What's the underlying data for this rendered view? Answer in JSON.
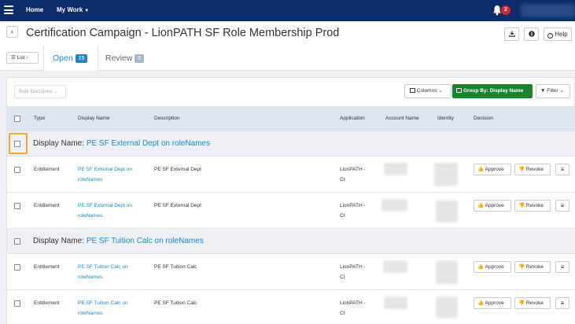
{
  "nav": {
    "home": "Home",
    "my_work": "My Work",
    "notifications_count": "2"
  },
  "header": {
    "title": "Certification Campaign - LionPATH SF Role Membership Prod",
    "help_label": "Help"
  },
  "tabs": {
    "list_label": "List",
    "open": {
      "label": "Open",
      "count": "15"
    },
    "review": {
      "label": "Review",
      "count": "0"
    }
  },
  "toolbar": {
    "bulk_decisions": "Bulk Decisions",
    "columns": "Columns",
    "group_by": "Group By: Display Name",
    "filter": "Filter"
  },
  "table": {
    "headers": [
      "Type",
      "Display Name",
      "Description",
      "Application",
      "Account Name",
      "Identity",
      "Decision"
    ],
    "groups": [
      {
        "prefix": "Display Name:",
        "value": "PE SF External Dept on roleNames",
        "rows": [
          {
            "type": "Entitlement",
            "display_line1": "PE SF External Dept on",
            "display_line2": "roleNames",
            "description": "PE SF External Dept",
            "app_line1": "LionPATH -",
            "app_line2": "CI",
            "approve": "Approve",
            "revoke": "Revoke"
          },
          {
            "type": "Entitlement",
            "display_line1": "PE SF External Dept on",
            "display_line2": "roleNames",
            "description": "PE SF External Dept",
            "app_line1": "LionPATH -",
            "app_line2": "CI",
            "approve": "Approve",
            "revoke": "Revoke"
          }
        ]
      },
      {
        "prefix": "Display Name:",
        "value": "PE SF Tuition Calc on roleNames",
        "rows": [
          {
            "type": "Entitlement",
            "display_line1": "PE SF Tuition Calc on",
            "display_line2": "roleNames",
            "description": "PE SF Tuition Calc",
            "app_line1": "LionPATH -",
            "app_line2": "CI",
            "approve": "Approve",
            "revoke": "Revoke"
          },
          {
            "type": "Entitlement",
            "display_line1": "PE SF Tuition Calc on",
            "display_line2": "roleNames",
            "description": "PE SF Tuition Calc",
            "app_line1": "LionPATH -",
            "app_line2": "CI",
            "approve": "Approve",
            "revoke": "Revoke"
          }
        ]
      }
    ]
  },
  "colors": {
    "nav_bg": "#0b2d6b",
    "accent": "#1e88c7",
    "group_by_green": "#19852f",
    "badge_red": "#d9262c",
    "highlight_orange": "#f2a93b"
  },
  "icons": [
    "menu-icon",
    "bell-icon",
    "chevron-left-icon",
    "download-icon",
    "info-icon",
    "help-icon",
    "list-icon",
    "columns-icon",
    "filter-icon",
    "thumbs-up-icon",
    "thumbs-down-icon",
    "hamburger-icon"
  ]
}
